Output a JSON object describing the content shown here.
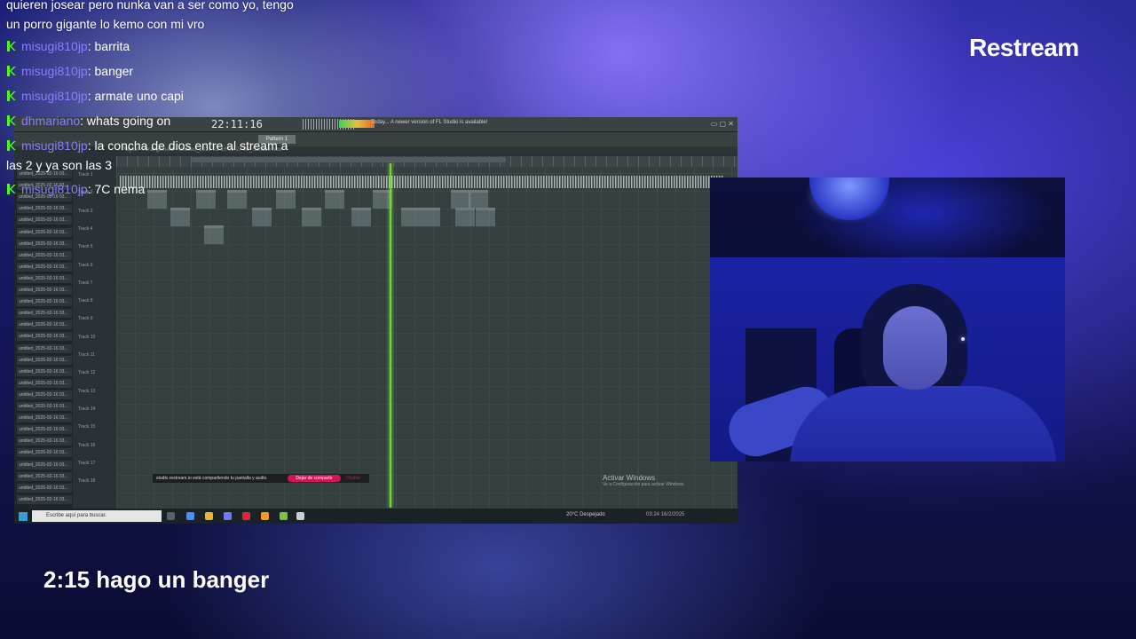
{
  "chat": {
    "top_message": "quieren josear pero nunka van a ser como yo, tengo\nun porro gigante lo kemo con mi vro",
    "messages": [
      {
        "user": "misugi810jp",
        "sep": ":",
        "text": " barrita"
      },
      {
        "user": "misugi810jp",
        "sep": ":",
        "text": " banger"
      },
      {
        "user": "misugi810jp",
        "sep": ":",
        "text": " armate uno capi"
      },
      {
        "user": "dhmariano",
        "sep": ":",
        "text": " whats going on"
      },
      {
        "user": "misugi810jp",
        "sep": ":",
        "text": " la concha de dios entre al stream a\nlas 2 y ya son las 3"
      },
      {
        "user": "misugi810jp",
        "sep": ":",
        "text": " 7C nema"
      }
    ]
  },
  "brand": "Restream",
  "caption": "2:15 hago un banger",
  "desktop": {
    "clock": "22:11:16",
    "pattern_label": "Pattern 1",
    "playlist_title": "Playlist - Arrangement › Untitled_2025-02-16 03-27-08_Sandbo now",
    "hint_text": "Today... A newer version of FL Studio is available!",
    "browser_items": [
      "untitled_2025-02-16 03...",
      "untitled_2025-02-16 03...",
      "untitled_2025-02-16 03...",
      "untitled_2025-02-16 03...",
      "untitled_2025-02-16 03...",
      "untitled_2025-02-16 03...",
      "untitled_2025-02-16 03...",
      "untitled_2025-02-16 03...",
      "untitled_2025-02-16 03...",
      "untitled_2025-02-16 03...",
      "untitled_2025-02-16 03...",
      "untitled_2025-02-16 03...",
      "untitled_2025-02-16 03...",
      "untitled_2025-02-16 03...",
      "untitled_2025-02-16 03...",
      "untitled_2025-02-16 03...",
      "untitled_2025-02-16 03...",
      "untitled_2025-02-16 03...",
      "untitled_2025-02-16 03...",
      "untitled_2025-02-16 03...",
      "untitled_2025-02-16 03...",
      "untitled_2025-02-16 03...",
      "untitled_2025-02-16 03...",
      "untitled_2025-02-16 03...",
      "untitled_2025-02-16 03...",
      "untitled_2025-02-16 03...",
      "untitled_2025-02-16 03...",
      "untitled_2025-02-16 03...",
      "untitled_2025-02-16 03..."
    ],
    "tracks": [
      "Track 1",
      "Track 2",
      "Track 3",
      "Track 4",
      "Track 5",
      "Track 6",
      "Track 7",
      "Track 8",
      "Track 9",
      "Track 10",
      "Track 11",
      "Track 12",
      "Track 13",
      "Track 14",
      "Track 15",
      "Track 16",
      "Track 17",
      "Track 18"
    ],
    "notification": "studio.restream.io está compartiendo tu pantalla y audio.",
    "stop_sharing": "Dejar de compartir",
    "hide": "Ocultar",
    "activate_title": "Activar Windows",
    "activate_sub": "Ve a Configuración para activar Windows.",
    "taskbar_search": "Escribe aquí para buscar.",
    "weather": "20°C  Despejado",
    "tray_time": "03:24",
    "tray_date": "16/2/2025"
  }
}
